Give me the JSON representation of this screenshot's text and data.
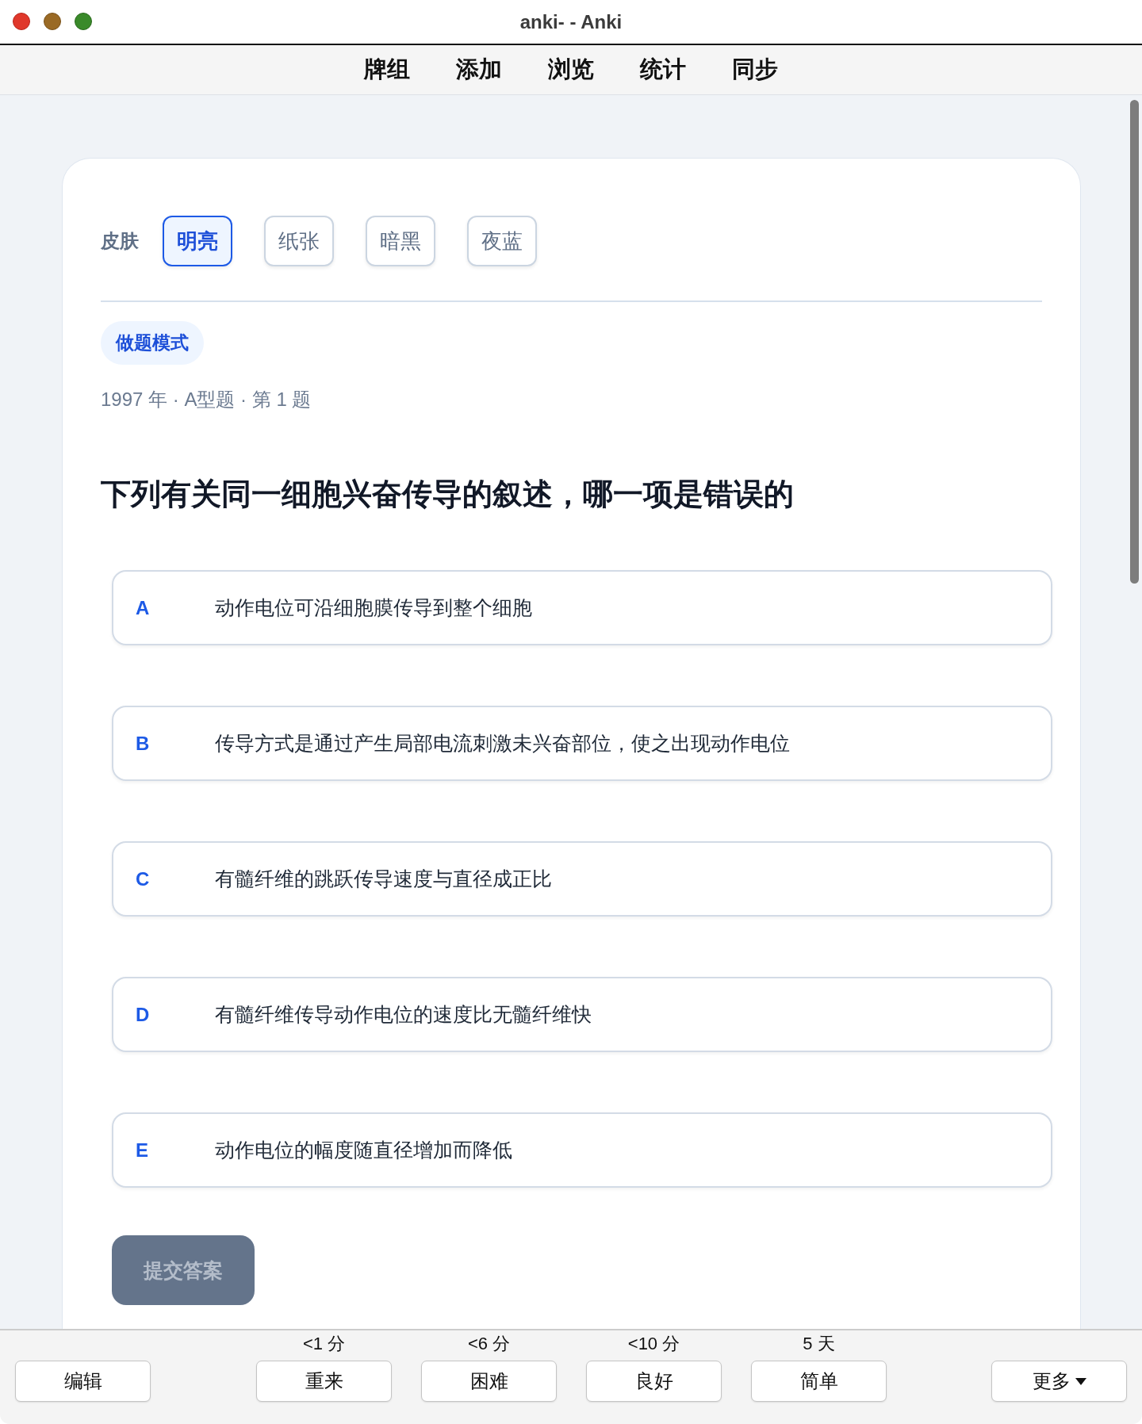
{
  "window": {
    "title": "anki- - Anki"
  },
  "menu": [
    "牌组",
    "添加",
    "浏览",
    "统计",
    "同步"
  ],
  "skin": {
    "label": "皮肤",
    "options": [
      {
        "label": "明亮",
        "selected": true
      },
      {
        "label": "纸张",
        "selected": false
      },
      {
        "label": "暗黑",
        "selected": false
      },
      {
        "label": "夜蓝",
        "selected": false
      }
    ]
  },
  "mode_badge": "做题模式",
  "meta": "1997 年 · A型题 · 第 1 题",
  "question": "下列有关同一细胞兴奋传导的叙述，哪一项是错误的",
  "options": [
    {
      "letter": "A",
      "text": "动作电位可沿细胞膜传导到整个细胞",
      "selected": false
    },
    {
      "letter": "B",
      "text": "传导方式是通过产生局部电流刺激未兴奋部位，使之出现动作电位",
      "selected": false
    },
    {
      "letter": "C",
      "text": "有髓纤维的跳跃传导速度与直径成正比",
      "selected": false
    },
    {
      "letter": "D",
      "text": "有髓纤维传导动作电位的速度比无髓纤维快",
      "selected": false
    },
    {
      "letter": "E",
      "text": "动作电位的幅度随直径增加而降低",
      "selected": false
    }
  ],
  "submit": {
    "label": "提交答案",
    "disabled": true
  },
  "bottom_bar": {
    "edit": "编辑",
    "answers": [
      {
        "time": "<1 分",
        "label": "重来"
      },
      {
        "time": "<6 分",
        "label": "困难"
      },
      {
        "time": "<10 分",
        "label": "良好"
      },
      {
        "time": "5 天",
        "label": "简单"
      }
    ],
    "more": "更多"
  }
}
